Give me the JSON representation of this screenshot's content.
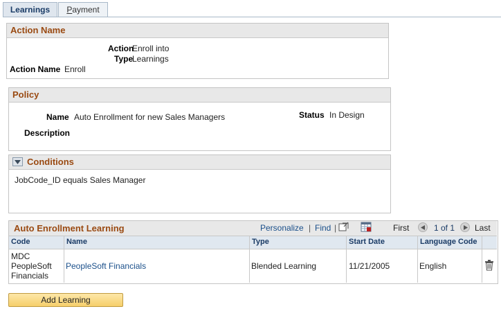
{
  "tabs": [
    {
      "label": "Learnings",
      "active": true
    },
    {
      "label": "Payment",
      "active": false,
      "accesskey": "P",
      "rest": "ayment"
    }
  ],
  "action_section": {
    "title": "Action Name",
    "action_type_label_1": "Action",
    "action_type_label_2": "Type",
    "action_type_value_1": "Enroll into",
    "action_type_value_2": "Learnings",
    "action_name_label": "Action Name",
    "action_name_value": "Enroll"
  },
  "policy_section": {
    "title": "Policy",
    "name_label": "Name",
    "name_value": "Auto Enrollment for new Sales Managers",
    "status_label": "Status",
    "status_value": "In Design",
    "description_label": "Description"
  },
  "conditions_section": {
    "title": "Conditions",
    "text": "JobCode_ID equals Sales Manager"
  },
  "grid": {
    "title": "Auto Enrollment Learning",
    "personalize": "Personalize",
    "separator": "|",
    "find": "Find",
    "first": "First",
    "counter": "1 of 1",
    "last": "Last",
    "columns": [
      "Code",
      "Name",
      "Type",
      "Start Date",
      "Language Code"
    ],
    "rows": [
      {
        "code_lines": [
          "MDC",
          "PeopleSoft",
          "Financials"
        ],
        "name": "PeopleSoft Financials",
        "type": "Blended Learning",
        "start_date": "11/21/2005",
        "language": "English"
      }
    ]
  },
  "add_button": "Add Learning",
  "colors": {
    "section_title": "#9a4a12",
    "link": "#1a4f8a",
    "header_bg": "#e8e8e8",
    "grid_header_bg": "#e0e8f0",
    "button_bg": "#f6cf6b"
  }
}
